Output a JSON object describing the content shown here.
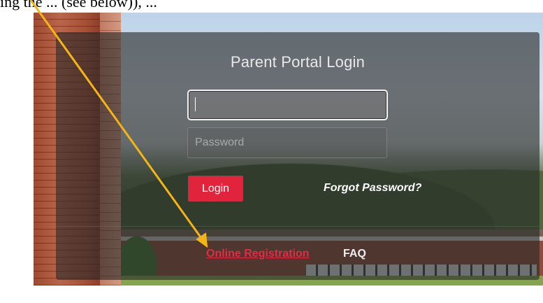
{
  "caption": {
    "text": "ing the ... (see below)), ..."
  },
  "login": {
    "title": "Parent Portal Login",
    "username_placeholder": "",
    "password_placeholder": "Password",
    "login_button": "Login",
    "forgot_link": "Forgot Password?",
    "online_registration_link": "Online Registration",
    "faq_link": "FAQ"
  },
  "colors": {
    "accent_red": "#e2233c",
    "link_red": "#e62a45",
    "annotation_arrow": "#f2b418"
  },
  "icons": {
    "annotation": "arrow-icon"
  }
}
